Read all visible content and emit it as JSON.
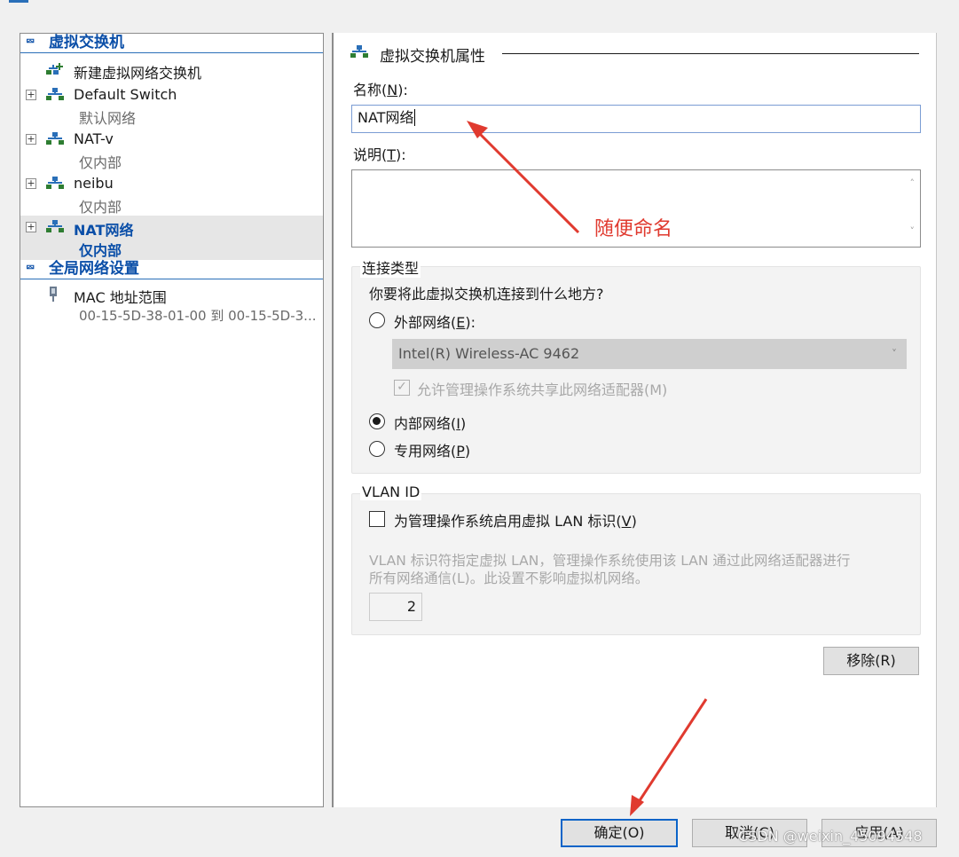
{
  "left_panel": {
    "sections": [
      {
        "header": "虚拟交换机",
        "items": [
          {
            "title": "新建虚拟网络交换机",
            "subtitle": ""
          },
          {
            "title": "Default Switch",
            "subtitle": "默认网络"
          },
          {
            "title": "NAT-v",
            "subtitle": "仅内部"
          },
          {
            "title": "neibu",
            "subtitle": "仅内部"
          },
          {
            "title": "NAT网络",
            "subtitle": "仅内部"
          }
        ]
      },
      {
        "header": "全局网络设置",
        "items": [
          {
            "title": "MAC 地址范围",
            "subtitle": "00-15-5D-38-01-00 到 00-15-5D-3..."
          }
        ]
      }
    ],
    "selected_item": "NAT网络"
  },
  "properties": {
    "section_title": "虚拟交换机属性",
    "name_label": "名称(",
    "name_key": "N",
    "name_label_end": "):",
    "name_value": "NAT网络",
    "desc_label": "说明(",
    "desc_key": "T",
    "desc_label_end": "):",
    "desc_value": "",
    "connection": {
      "group_title": "连接类型",
      "question": "你要将此虚拟交换机连接到什么地方?",
      "external_label": "外部网络(",
      "external_key": "E",
      "external_label_end": "):",
      "adapter_value": "Intel(R) Wireless-AC 9462",
      "allow_mgmt_label": "允许管理操作系统共享此网络适配器(M)",
      "internal_label": "内部网络(",
      "internal_key": "I",
      "internal_label_end": ")",
      "private_label": "专用网络(",
      "private_key": "P",
      "private_label_end": ")",
      "selected": "internal"
    },
    "vlan": {
      "group_title": "VLAN ID",
      "enable_label": "为管理操作系统启用虚拟 LAN 标识(",
      "enable_key": "V",
      "enable_label_end": ")",
      "description_line1": "VLAN 标识符指定虚拟 LAN，管理操作系统使用该 LAN 通过此网络适配器进行",
      "description_line2": "所有网络通信(L)。此设置不影响虚拟机网络。",
      "value": "2",
      "enabled": false
    },
    "remove_button": "移除(R)"
  },
  "footer": {
    "ok_button": "确定(O)",
    "cancel_button": "取消(C)",
    "apply_button": "应用(A)"
  },
  "annotation": {
    "text": "随便命名",
    "color": "#e03a2f"
  },
  "watermark": "CSDN @weixin_45094548",
  "colors": {
    "accent": "#0b4fa8",
    "selection_bg": "#e6e6e6",
    "default_button_border": "#0a64c8"
  }
}
